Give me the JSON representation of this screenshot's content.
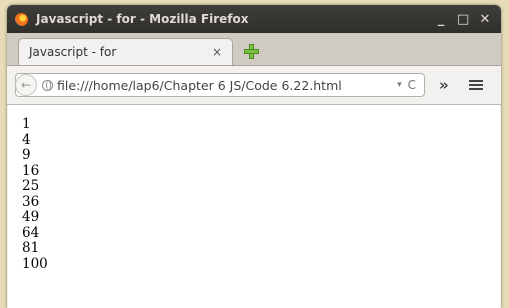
{
  "window": {
    "title": "Javascript - for - Mozilla Firefox",
    "controls": [
      "_",
      "□",
      "✕"
    ]
  },
  "tab": {
    "label": "Javascript - for",
    "close": "×"
  },
  "navbar": {
    "url": "file:///home/lap6/Chapter 6 JS/Code 6.22.html",
    "dropdown": "▾",
    "reload": "C",
    "overflow": "»"
  },
  "content": {
    "lines": [
      "1",
      "4",
      "9",
      "16",
      "25",
      "36",
      "49",
      "64",
      "81",
      "100"
    ]
  }
}
